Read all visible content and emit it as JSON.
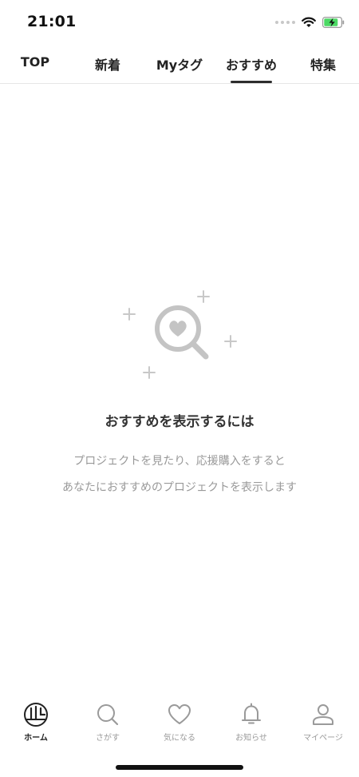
{
  "status_bar": {
    "time": "21:01"
  },
  "tabs": [
    {
      "label": "TOP",
      "active": false
    },
    {
      "label": "新着",
      "active": false
    },
    {
      "label": "Myタグ",
      "active": false
    },
    {
      "label": "おすすめ",
      "active": true
    },
    {
      "label": "特集",
      "active": false
    }
  ],
  "empty_state": {
    "title": "おすすめを表示するには",
    "desc_line1": "プロジェクトを見たり、応援購入をすると",
    "desc_line2": "あなたにおすすめのプロジェクトを表示します"
  },
  "bottom_nav": [
    {
      "label": "ホーム",
      "icon": "home-logo-icon",
      "active": true
    },
    {
      "label": "さがす",
      "icon": "search-icon",
      "active": false
    },
    {
      "label": "気になる",
      "icon": "heart-icon",
      "active": false
    },
    {
      "label": "お知らせ",
      "icon": "bell-icon",
      "active": false
    },
    {
      "label": "マイページ",
      "icon": "user-icon",
      "active": false
    }
  ],
  "colors": {
    "active_text": "#222222",
    "inactive_text": "#9a9a9a",
    "illustration": "#c4c4c4",
    "divider": "#e6e6e6"
  }
}
